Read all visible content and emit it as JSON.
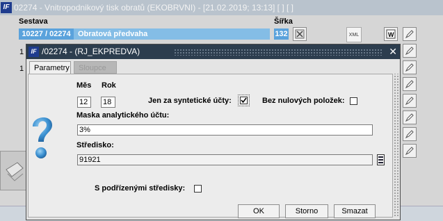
{
  "background": {
    "title": "02274 - Vnitropodnikový tisk obratů (EKOBRVNI) - [21.02.2019; 13:13]  [ ]  [ ]",
    "headers": {
      "sestava": "Sestava",
      "sirka": "Šířka"
    },
    "selected_row": {
      "code": "10227 / 02274",
      "name": "Obratová předvaha",
      "width": "132"
    },
    "row_numbers": [
      "1",
      "1"
    ],
    "xml_label": "XML"
  },
  "dialog": {
    "title": "/02274 - (RJ_EKPREDVA)",
    "close_glyph": "✕",
    "tabs": [
      {
        "label": "Parametry",
        "active": true
      },
      {
        "label": "Sloupce",
        "active": false
      }
    ],
    "fields": {
      "mes_label": "Měs",
      "mes_value": "12",
      "rok_label": "Rok",
      "rok_value": "18",
      "syntetic_label": "Jen za syntetické účty:",
      "syntetic_checked": true,
      "nonzero_label": "Bez nulových položek:",
      "nonzero_checked": false,
      "mask_label": "Maska analytického účtu:",
      "mask_value": "3%",
      "stredisko_label": "Středisko:",
      "stredisko_value": "91921",
      "podrizene_label": "S podřízenými středisky:",
      "podrizene_checked": false
    },
    "buttons": {
      "ok": "OK",
      "storno": "Storno",
      "smazat": "Smazat"
    }
  },
  "colors": {
    "dialog_titlebar": "#2c3d4e",
    "selection": "#5aa2dc",
    "selection_light": "#84bde6"
  }
}
